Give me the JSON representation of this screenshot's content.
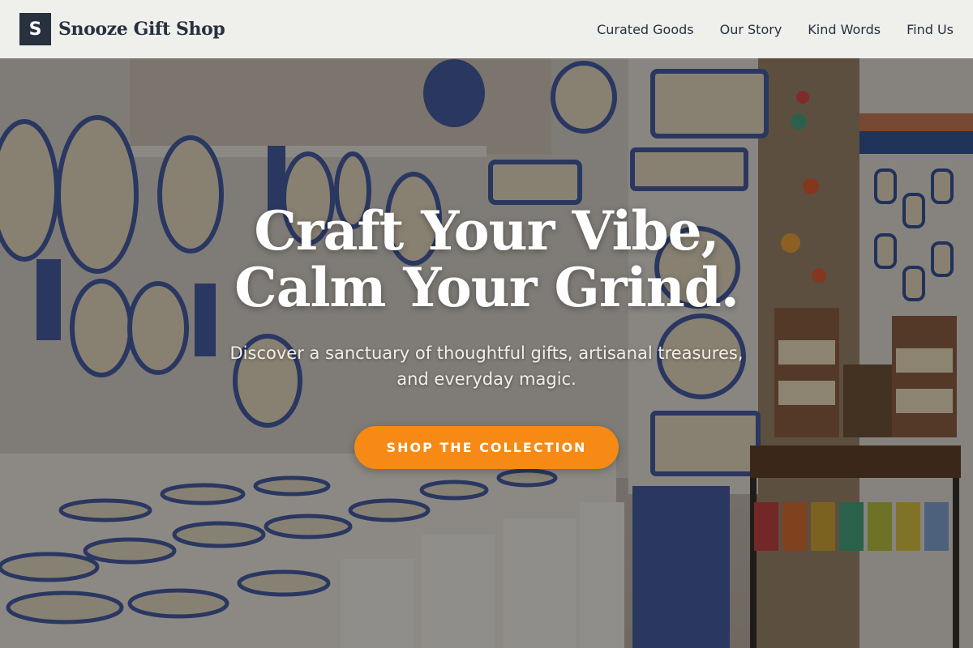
{
  "header": {
    "logo_letter": "S",
    "brand_name": "Snooze Gift Shop",
    "nav": [
      {
        "label": "Curated Goods"
      },
      {
        "label": "Our Story"
      },
      {
        "label": "Kind Words"
      },
      {
        "label": "Find Us"
      }
    ]
  },
  "hero": {
    "title_line1": "Craft Your Vibe,",
    "title_line2": "Calm Your Grind.",
    "subtitle": "Discover a sanctuary of thoughtful gifts, artisanal treasures, and everyday magic.",
    "cta_label": "SHOP THE COLLECTION",
    "background_icon": "shop-interior-ceramics-image"
  },
  "colors": {
    "brand_dark": "#27313f",
    "accent_orange": "#f68a14",
    "header_bg": "#f8f7f5",
    "text_light": "#ffffff"
  }
}
